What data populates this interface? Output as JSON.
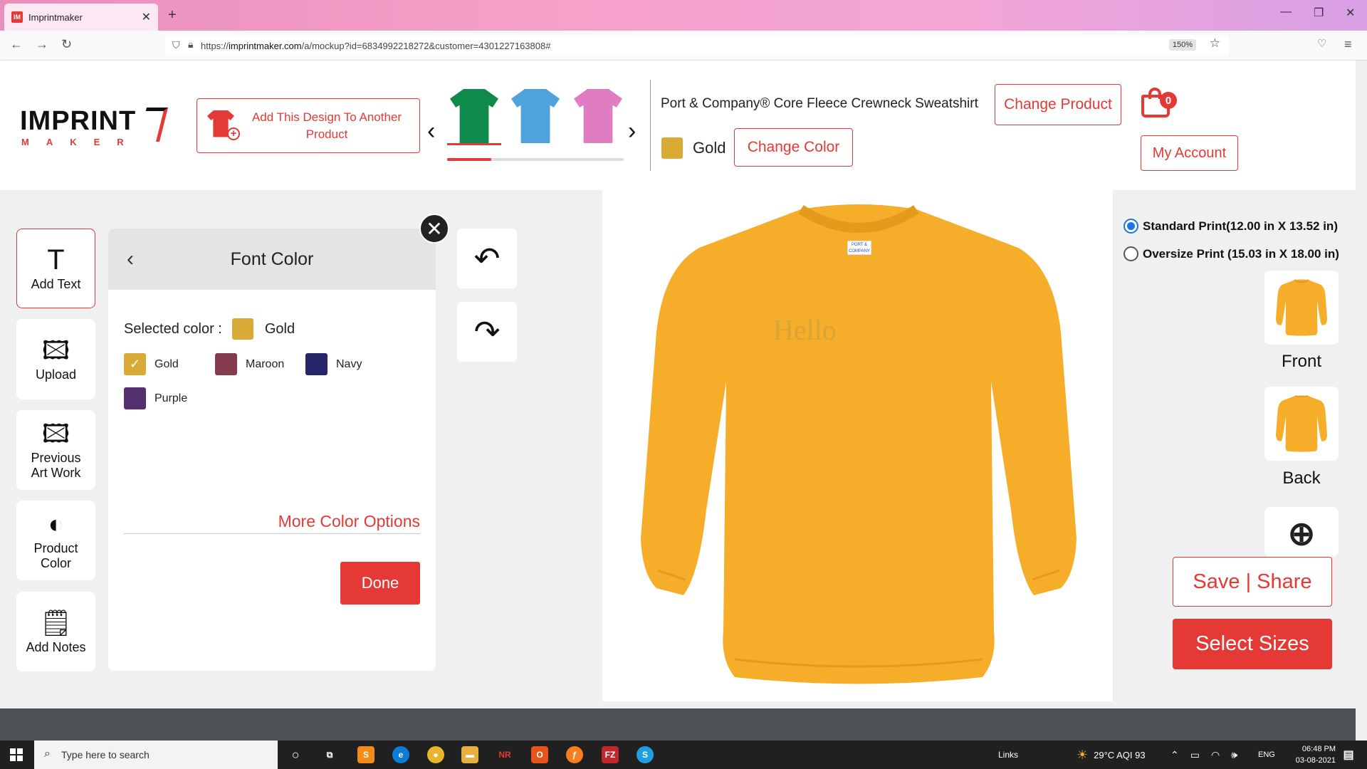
{
  "browser": {
    "tab_title": "Imprintmaker",
    "tab_favicon": "IM",
    "url_prefix": "https://",
    "url_host": "imprintmaker.com",
    "url_path": "/a/mockup?id=6834992218272&customer=4301227163808#",
    "zoom": "150%"
  },
  "header": {
    "logo_main": "IMPRINT",
    "logo_sub": "MAKER",
    "add_design_label": "Add This Design To Another Product",
    "product_name": "Port & Company® Core Fleece Crewneck Sweatshirt",
    "change_product_label": "Change Product",
    "color_name": "Gold",
    "change_color_label": "Change Color",
    "cart_count": "0",
    "my_account_label": "My Account",
    "carousel_products": [
      {
        "color": "#0d8a4c",
        "type": "sweatshirt"
      },
      {
        "color": "#4ea3dc",
        "type": "tshirt"
      },
      {
        "color": "#e07cc0",
        "type": "vneck"
      }
    ],
    "carousel_progress": 0.25
  },
  "tools": {
    "add_text": "Add Text",
    "upload": "Upload",
    "previous_art_line1": "Previous",
    "previous_art_line2": "Art Work",
    "product_color_line1": "Product",
    "product_color_line2": "Color",
    "add_notes": "Add Notes"
  },
  "font_color_panel": {
    "title": "Font Color",
    "selected_label": "Selected color :",
    "selected_value": "Gold",
    "selected_hex": "#d9ab36",
    "options": [
      {
        "name": "Gold",
        "hex": "#d9ab36",
        "checked": true
      },
      {
        "name": "Maroon",
        "hex": "#843b4d",
        "checked": false
      },
      {
        "name": "Navy",
        "hex": "#27266b",
        "checked": false
      },
      {
        "name": "Purple",
        "hex": "#55306f",
        "checked": false
      }
    ],
    "more_colors_label": "More Color Options",
    "done_label": "Done"
  },
  "canvas": {
    "design_text": "Hello",
    "garment_color": "#f6ad2a",
    "tag_text": "PORT & COMPANY"
  },
  "print_options": [
    {
      "label": "Standard Print(12.00 in X 13.52 in)",
      "selected": true
    },
    {
      "label": "Oversize Print (15.03 in X 18.00 in)",
      "selected": false
    }
  ],
  "views": {
    "front": "Front",
    "back": "Back"
  },
  "actions": {
    "save_share": "Save | Share",
    "select_sizes": "Select Sizes"
  },
  "taskbar": {
    "search_placeholder": "Type here to search",
    "links": "Links",
    "weather": "29°C  AQI 93",
    "lang": "ENG",
    "time": "06:48 PM",
    "date": "03-08-2021"
  },
  "colors": {
    "accent": "#e53935",
    "gold": "#d9ab36"
  }
}
